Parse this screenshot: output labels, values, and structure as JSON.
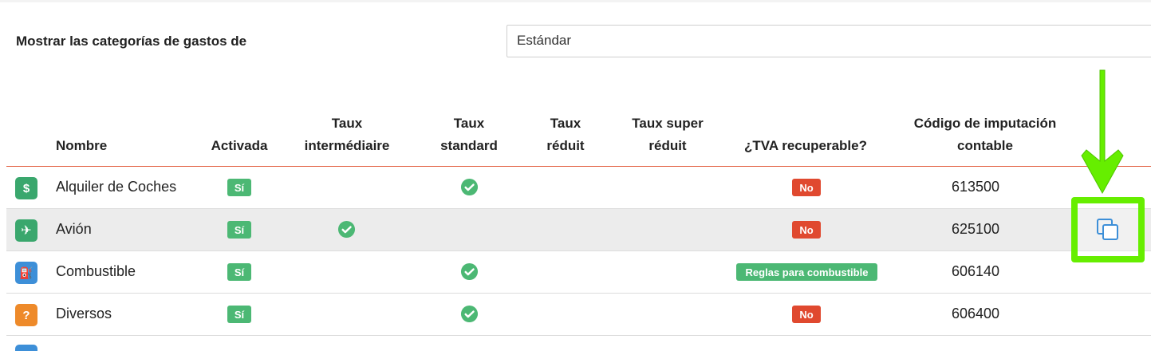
{
  "filter": {
    "label": "Mostrar las categorías de gastos de",
    "selected": "Estándar"
  },
  "table": {
    "headers": {
      "name": "Nombre",
      "active": "Activada",
      "intermediate_1": "Taux",
      "intermediate_2": "intermédiaire",
      "standard_1": "Taux",
      "standard_2": "standard",
      "reduced_1": "Taux",
      "reduced_2": "réduit",
      "super_reduced_1": "Taux super",
      "super_reduced_2": "réduit",
      "vat": "¿TVA recuperable?",
      "code_1": "Código de imputación",
      "code_2": "contable"
    },
    "rows": [
      {
        "name": "Alquiler de Coches",
        "icon": "car-rental-icon",
        "icon_color": "#3aa76d",
        "icon_glyph": "$",
        "active": "Sí",
        "rate": "standard",
        "vat": "No",
        "code": "613500"
      },
      {
        "name": "Avión",
        "icon": "airplane-icon",
        "icon_color": "#3aa76d",
        "icon_glyph": "✈",
        "active": "Sí",
        "rate": "intermediate",
        "vat": "No",
        "code": "625100"
      },
      {
        "name": "Combustible",
        "icon": "fuel-pump-icon",
        "icon_color": "#3d8fd8",
        "icon_glyph": "⛽",
        "active": "Sí",
        "rate": "standard",
        "vat": "Reglas para combustible",
        "code": "606140"
      },
      {
        "name": "Diversos",
        "icon": "question-icon",
        "icon_color": "#ee8a2a",
        "icon_glyph": "?",
        "active": "Sí",
        "rate": "standard",
        "vat": "No",
        "code": "606400"
      }
    ]
  },
  "colors": {
    "header_rule": "#e15b3b",
    "badge_green": "#4cb874",
    "badge_red": "#e0492f",
    "highlight": "#66ee00",
    "copy_icon": "#3d8fd8"
  },
  "actions": {
    "copy_icon": "copy-icon"
  }
}
